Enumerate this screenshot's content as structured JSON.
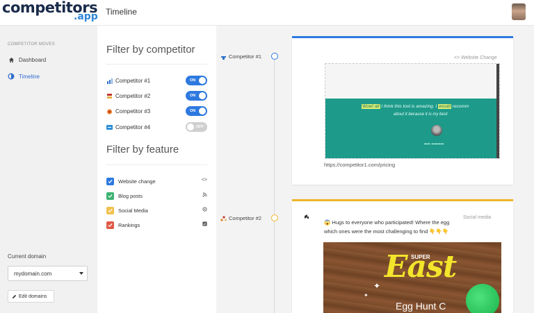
{
  "header": {
    "logo_main": "competitors",
    "logo_app": ".app",
    "page_title": "Timeline"
  },
  "sidebar": {
    "section_label": "COMPETITOR MOVES",
    "items": [
      {
        "label": "Dashboard",
        "icon": "home-icon",
        "active": false
      },
      {
        "label": "Timeline",
        "icon": "timeline-icon",
        "active": true
      }
    ],
    "current_domain_label": "Current domain",
    "domain_value": "mydomain.com",
    "edit_domains_label": "Edit domains"
  },
  "filters": {
    "competitor_title": "Filter by competitor",
    "competitors": [
      {
        "name": "Competitor #1",
        "toggle": "ON",
        "color": "#2d6fc7"
      },
      {
        "name": "Competitor #2",
        "toggle": "ON",
        "color": "#c0392b"
      },
      {
        "name": "Competitor #3",
        "toggle": "ON",
        "color": "#e67e22"
      },
      {
        "name": "Competitor #4",
        "toggle": "OFF",
        "color": "#2e8fd8"
      }
    ],
    "feature_title": "Filter by feature",
    "features": [
      {
        "label": "Website change",
        "color": "#2d79e0",
        "icon": "<>"
      },
      {
        "label": "Blog posts",
        "color": "#3cb371",
        "icon": "rss-icon"
      },
      {
        "label": "Social Media",
        "color": "#f2c14e",
        "icon": "social-icon"
      },
      {
        "label": "Rankings",
        "color": "#e05a47",
        "icon": "rankings-icon"
      }
    ]
  },
  "timeline": {
    "entries": [
      {
        "competitor": "Competitor #1",
        "tag": "<> Website Change",
        "quote_hl1": "Wow! all",
        "quote_mid": "I think this tool is amazing. I",
        "quote_hl2": "would",
        "quote_end": "recomm",
        "quote_line2": "about it because it is my best",
        "url": "https://competitor1.com/pricing"
      },
      {
        "competitor": "Competitor #2",
        "tag": "Social media",
        "post_text": "😱 Hugs to everyone who participated! Where the egg which ones were the most challenging to find 👇👇👇",
        "image_title": "East",
        "image_top": "SUPER",
        "image_sub": "Egg Hunt C"
      }
    ]
  },
  "colors": {
    "accent_blue": "#2d79e0",
    "accent_yellow": "#f0b429",
    "teal": "#1d9a8a"
  }
}
